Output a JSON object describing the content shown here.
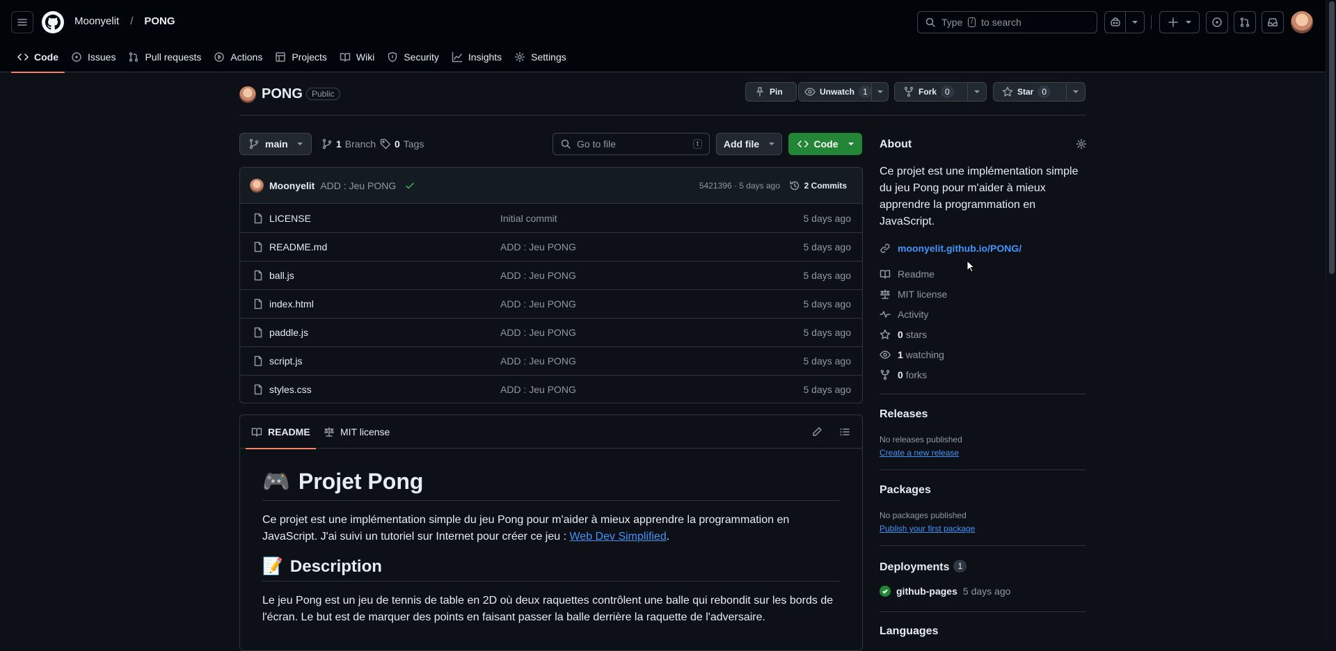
{
  "header": {
    "owner": "Moonyelit",
    "separator": "/",
    "repo": "PONG",
    "search_pre": "Type",
    "search_key": "/",
    "search_post": "to search"
  },
  "nav_tabs": [
    {
      "label": "Code",
      "icon": "code-icon"
    },
    {
      "label": "Issues",
      "icon": "issue-icon"
    },
    {
      "label": "Pull requests",
      "icon": "pull-request-icon"
    },
    {
      "label": "Actions",
      "icon": "play-icon"
    },
    {
      "label": "Projects",
      "icon": "table-icon"
    },
    {
      "label": "Wiki",
      "icon": "book-icon"
    },
    {
      "label": "Security",
      "icon": "shield-icon"
    },
    {
      "label": "Insights",
      "icon": "graph-icon"
    },
    {
      "label": "Settings",
      "icon": "gear-icon"
    }
  ],
  "repo_header": {
    "title": "PONG",
    "visibility": "Public",
    "pin_label": "Pin",
    "watch_label": "Unwatch",
    "watch_count": "1",
    "fork_label": "Fork",
    "fork_count": "0",
    "star_label": "Star",
    "star_count": "0"
  },
  "toolbar": {
    "branch": "main",
    "branch_count": "1",
    "branch_label": "Branch",
    "tag_count": "0",
    "tag_label": "Tags",
    "goto_placeholder": "Go to file",
    "goto_key": "t",
    "add_file_label": "Add file",
    "code_label": "Code"
  },
  "latest_commit": {
    "author": "Moonyelit",
    "message": "ADD : Jeu PONG",
    "meta": "5421396 · 5 days ago",
    "commits_label": "2 Commits"
  },
  "files": [
    {
      "name": "LICENSE",
      "message": "Initial commit",
      "date": "5 days ago"
    },
    {
      "name": "README.md",
      "message": "ADD : Jeu PONG",
      "date": "5 days ago"
    },
    {
      "name": "ball.js",
      "message": "ADD : Jeu PONG",
      "date": "5 days ago"
    },
    {
      "name": "index.html",
      "message": "ADD : Jeu PONG",
      "date": "5 days ago"
    },
    {
      "name": "paddle.js",
      "message": "ADD : Jeu PONG",
      "date": "5 days ago"
    },
    {
      "name": "script.js",
      "message": "ADD : Jeu PONG",
      "date": "5 days ago"
    },
    {
      "name": "styles.css",
      "message": "ADD : Jeu PONG",
      "date": "5 days ago"
    }
  ],
  "readme": {
    "tab_readme": "README",
    "tab_license": "MIT license",
    "h1_emoji": "🎮",
    "h1": "Projet Pong",
    "p1": "Ce projet est une implémentation simple du jeu Pong pour m'aider à mieux apprendre la programmation en JavaScript. J'ai suivi un tutoriel sur Internet pour créer ce jeu : ",
    "p1_link": "Web Dev Simplified",
    "p1_end": ".",
    "h2_emoji": "📝",
    "h2": "Description",
    "p2": "Le jeu Pong est un jeu de tennis de table en 2D où deux raquettes contrôlent une balle qui rebondit sur les bords de l'écran. Le but est de marquer des points en faisant passer la balle derrière la raquette de l'adversaire."
  },
  "about": {
    "title": "About",
    "description": "Ce projet est une implémentation simple du jeu Pong pour m'aider à mieux apprendre la programmation en JavaScript.",
    "homepage": "moonyelit.github.io/PONG/",
    "readme": "Readme",
    "license": "MIT license",
    "activity": "Activity",
    "stars_count": "0",
    "stars_label": "stars",
    "watching_count": "1",
    "watching_label": "watching",
    "forks_count": "0",
    "forks_label": "forks"
  },
  "releases": {
    "title": "Releases",
    "none": "No releases published",
    "link": "Create a new release"
  },
  "packages": {
    "title": "Packages",
    "none": "No packages published",
    "link": "Publish your first package"
  },
  "deployments": {
    "title": "Deployments",
    "count": "1",
    "name": "github-pages",
    "time": "5 days ago"
  },
  "languages": {
    "title": "Languages"
  },
  "colors": {
    "accent": "#f78166",
    "link": "#4493f8",
    "success": "#238636"
  }
}
